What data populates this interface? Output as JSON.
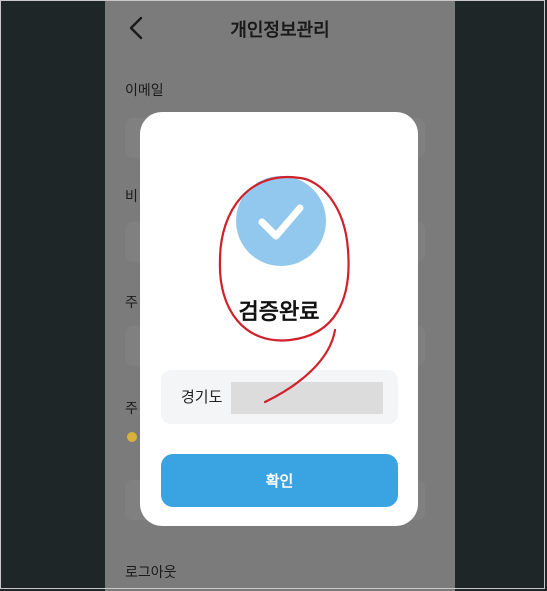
{
  "header": {
    "title": "개인정보관리",
    "back_icon": "chevron-left-icon"
  },
  "form": {
    "labels": [
      "이메일",
      "비",
      "주",
      "주"
    ],
    "logout_label": "로그아웃"
  },
  "dialog": {
    "icon": "check-circle-icon",
    "title": "검증완료",
    "address_prefix": "경기도",
    "confirm_label": "확인"
  },
  "colors": {
    "accent": "#3aa3e2",
    "check_circle": "#93c8ee",
    "annotation": "#d0202a",
    "overlay_screen": "#7b7b7b"
  }
}
